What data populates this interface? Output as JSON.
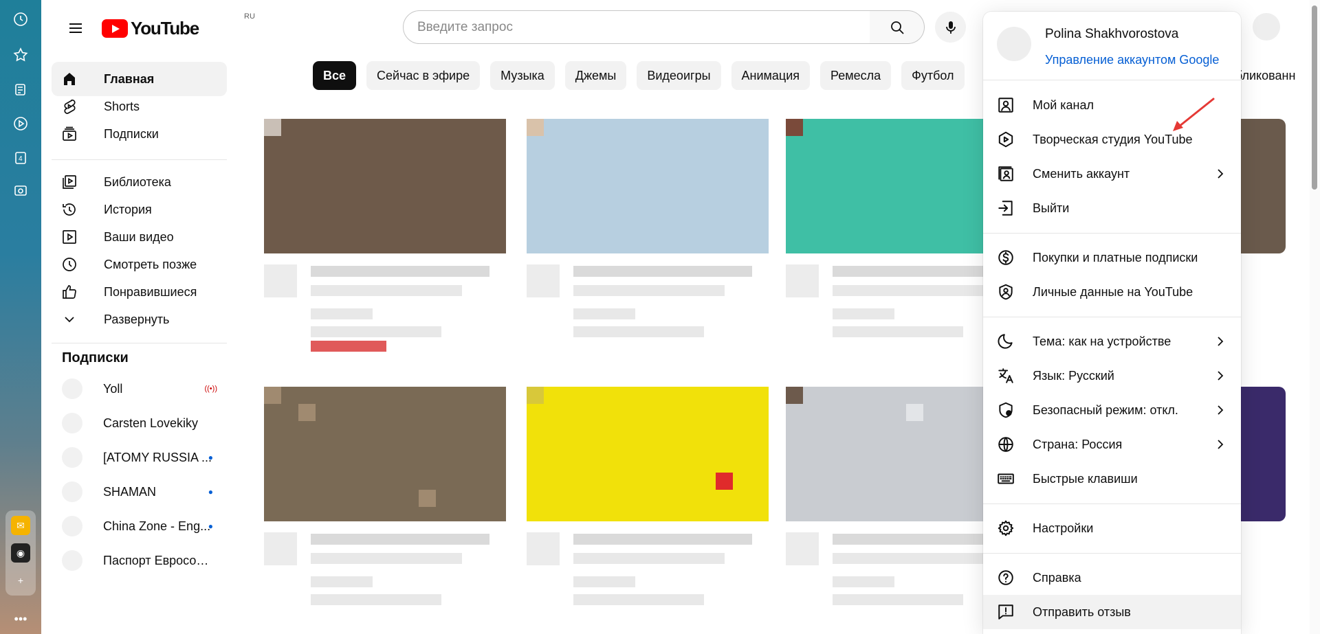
{
  "masthead": {
    "logo_text": "YouTube",
    "region": "RU",
    "search_placeholder": "Введите запрос"
  },
  "guide": {
    "primary": [
      {
        "label": "Главная",
        "icon": "home-icon",
        "active": true
      },
      {
        "label": "Shorts",
        "icon": "shorts-icon"
      },
      {
        "label": "Подписки",
        "icon": "subscriptions-icon"
      }
    ],
    "secondary": [
      {
        "label": "Библиотека",
        "icon": "library-icon"
      },
      {
        "label": "История",
        "icon": "history-icon"
      },
      {
        "label": "Ваши видео",
        "icon": "your-videos-icon"
      },
      {
        "label": "Смотреть позже",
        "icon": "watch-later-icon"
      },
      {
        "label": "Понравившиеся",
        "icon": "like-icon"
      },
      {
        "label": "Развернуть",
        "icon": "chevron-down-icon"
      }
    ],
    "subscriptions_heading": "Подписки",
    "subscriptions": [
      {
        "name": "Yoll",
        "badge": "live"
      },
      {
        "name": "Carsten Lovekiky",
        "badge": ""
      },
      {
        "name": "[ATOMY RUSSIA ...",
        "badge": "new"
      },
      {
        "name": "SHAMAN",
        "badge": "new"
      },
      {
        "name": "China Zone - Eng...",
        "badge": "new"
      },
      {
        "name": "Паспорт Евросою...",
        "badge": ""
      }
    ]
  },
  "chips": [
    "Все",
    "Сейчас в эфире",
    "Музыка",
    "Джемы",
    "Видеоигры",
    "Анимация",
    "Ремесла",
    "Футбол"
  ],
  "chip_tail": "бликованн",
  "account_menu": {
    "name": "Polina Shakhvorostova",
    "manage_link": "Управление аккаунтом Google",
    "groups": [
      [
        {
          "label": "Мой канал",
          "icon": "channel-icon"
        },
        {
          "label": "Творческая студия YouTube",
          "icon": "studio-icon"
        },
        {
          "label": "Сменить аккаунт",
          "icon": "switch-account-icon",
          "chevron": true
        },
        {
          "label": "Выйти",
          "icon": "sign-out-icon"
        }
      ],
      [
        {
          "label": "Покупки и платные подписки",
          "icon": "purchases-icon"
        },
        {
          "label": "Личные данные на YouTube",
          "icon": "personal-data-icon"
        }
      ],
      [
        {
          "label": "Тема: как на устройстве",
          "icon": "theme-icon",
          "chevron": true
        },
        {
          "label": "Язык: Русский",
          "icon": "language-icon",
          "chevron": true
        },
        {
          "label": "Безопасный режим: откл.",
          "icon": "restricted-mode-icon",
          "chevron": true
        },
        {
          "label": "Страна: Россия",
          "icon": "location-icon",
          "chevron": true
        },
        {
          "label": "Быстрые клавиши",
          "icon": "keyboard-icon"
        }
      ],
      [
        {
          "label": "Настройки",
          "icon": "settings-icon"
        }
      ],
      [
        {
          "label": "Справка",
          "icon": "help-icon"
        },
        {
          "label": "Отправить отзыв",
          "icon": "feedback-icon",
          "hover": true
        }
      ]
    ]
  },
  "colors": {
    "brand_red": "#ff0000",
    "link_blue": "#065fd4",
    "annotation_arrow": "#e53935"
  }
}
